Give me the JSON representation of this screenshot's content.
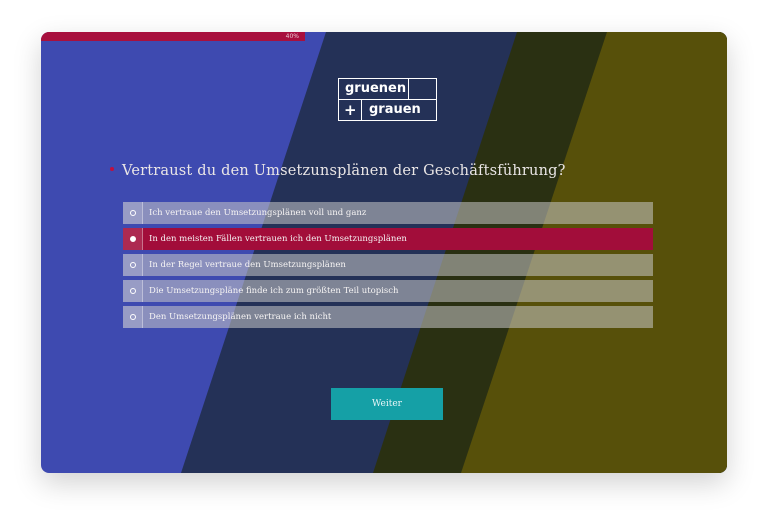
{
  "progress": {
    "label": "40%",
    "fraction": 0.4
  },
  "logo": {
    "line1": "gruenen",
    "plus": "+",
    "line2": "grauen"
  },
  "question": {
    "text": "Vertraust du den Umsetzunsplänen der Geschäftsführung?"
  },
  "options": [
    {
      "label": "Ich vertraue den Umsetzungsplänen voll und ganz",
      "selected": false
    },
    {
      "label": "In den meisten Fällen vertrauen ich den Umsetzungsplänen",
      "selected": true
    },
    {
      "label": "In der Regel vertraue den Umsetzungsplänen",
      "selected": false
    },
    {
      "label": "Die Umsetzungspläne finde ich zum größten Teil utopisch",
      "selected": false
    },
    {
      "label": "Den Umsetzungsplänen vertraue ich nicht",
      "selected": false
    }
  ],
  "next_button": {
    "label": "Weiter"
  },
  "colors": {
    "band_blue": "#3e4ab0",
    "band_navy": "#243157",
    "band_darkolive": "#2a3012",
    "band_olive": "#57500a",
    "accent_red": "#a8103e",
    "button_teal": "#15a0a6"
  }
}
